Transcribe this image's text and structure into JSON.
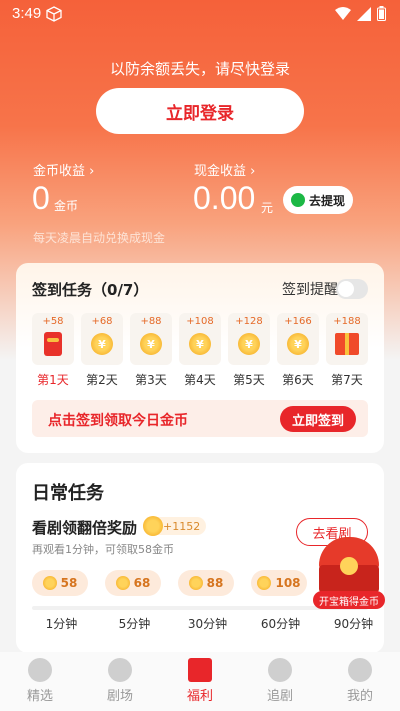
{
  "status_bar": {
    "time": "3:49"
  },
  "header": {
    "login_hint": "以防余额丢失，请尽快登录",
    "login_button": "立即登录",
    "coin_income_label": "金币收益",
    "coin_value": "0",
    "coin_unit": "金币",
    "cash_income_label": "现金收益",
    "cash_value": "0.00",
    "cash_unit": "元",
    "withdraw_button": "去提现",
    "auto_convert_note": "每天凌晨自动兑换成现金"
  },
  "checkin": {
    "title": "签到任务（0/7）",
    "reminder_label": "签到提醒",
    "reminder_on": false,
    "days": [
      {
        "amount": "+58",
        "label": "第1天",
        "icon": "red-packet-icon"
      },
      {
        "amount": "+68",
        "label": "第2天",
        "icon": "coin-icon"
      },
      {
        "amount": "+88",
        "label": "第3天",
        "icon": "coin-icon"
      },
      {
        "amount": "+108",
        "label": "第4天",
        "icon": "coin-icon"
      },
      {
        "amount": "+128",
        "label": "第5天",
        "icon": "coin-icon"
      },
      {
        "amount": "+166",
        "label": "第6天",
        "icon": "coin-icon"
      },
      {
        "amount": "+188",
        "label": "第7天",
        "icon": "gift-box-icon"
      }
    ],
    "prompt": "点击签到领取今日金币",
    "sign_button": "立即签到"
  },
  "daily": {
    "title": "日常任务",
    "task_name": "看剧领翻倍奖励",
    "task_bonus": "+1152",
    "task_sub": "再观看1分钟，可领取58金币",
    "watch_button": "去看剧",
    "rewards": [
      {
        "coins": "58",
        "minutes": "1分钟"
      },
      {
        "coins": "68",
        "minutes": "5分钟"
      },
      {
        "coins": "88",
        "minutes": "30分钟"
      },
      {
        "coins": "108",
        "minutes": "60分钟"
      },
      {
        "coins": "",
        "minutes": "90分钟"
      }
    ],
    "treasure_label": "开宝箱得金币"
  },
  "tabbar": {
    "tabs": [
      {
        "label": "精选",
        "icon": "play-icon"
      },
      {
        "label": "剧场",
        "icon": "tv-icon"
      },
      {
        "label": "福利",
        "icon": "red-packet-icon",
        "active": true
      },
      {
        "label": "追剧",
        "icon": "star-icon"
      },
      {
        "label": "我的",
        "icon": "profile-icon"
      }
    ]
  },
  "colors": {
    "accent": "#e8262a",
    "hero_top": "#f5613a",
    "coin": "#f3a318"
  }
}
